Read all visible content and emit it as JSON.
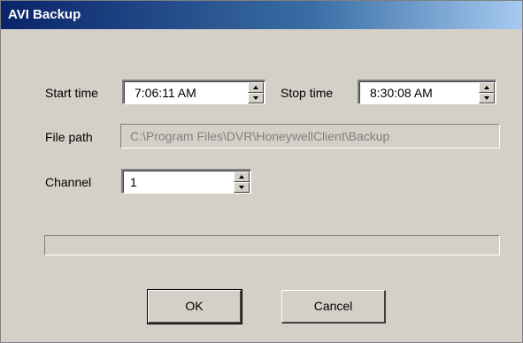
{
  "window": {
    "title": "AVI Backup"
  },
  "fields": {
    "start_time_label": "Start time",
    "start_time_value": "7:06:11 AM",
    "stop_time_label": "Stop time",
    "stop_time_value": "8:30:08 AM",
    "file_path_label": "File path",
    "file_path_value": "C:\\Program Files\\DVR\\HoneywellClient\\Backup",
    "channel_label": "Channel",
    "channel_value": "1"
  },
  "progress": {
    "fraction": 0
  },
  "buttons": {
    "ok_label": "OK",
    "cancel_label": "Cancel"
  },
  "colors": {
    "titlebar": "#0a246a",
    "face": "#d4d0c8",
    "disabled_text": "#808080"
  }
}
